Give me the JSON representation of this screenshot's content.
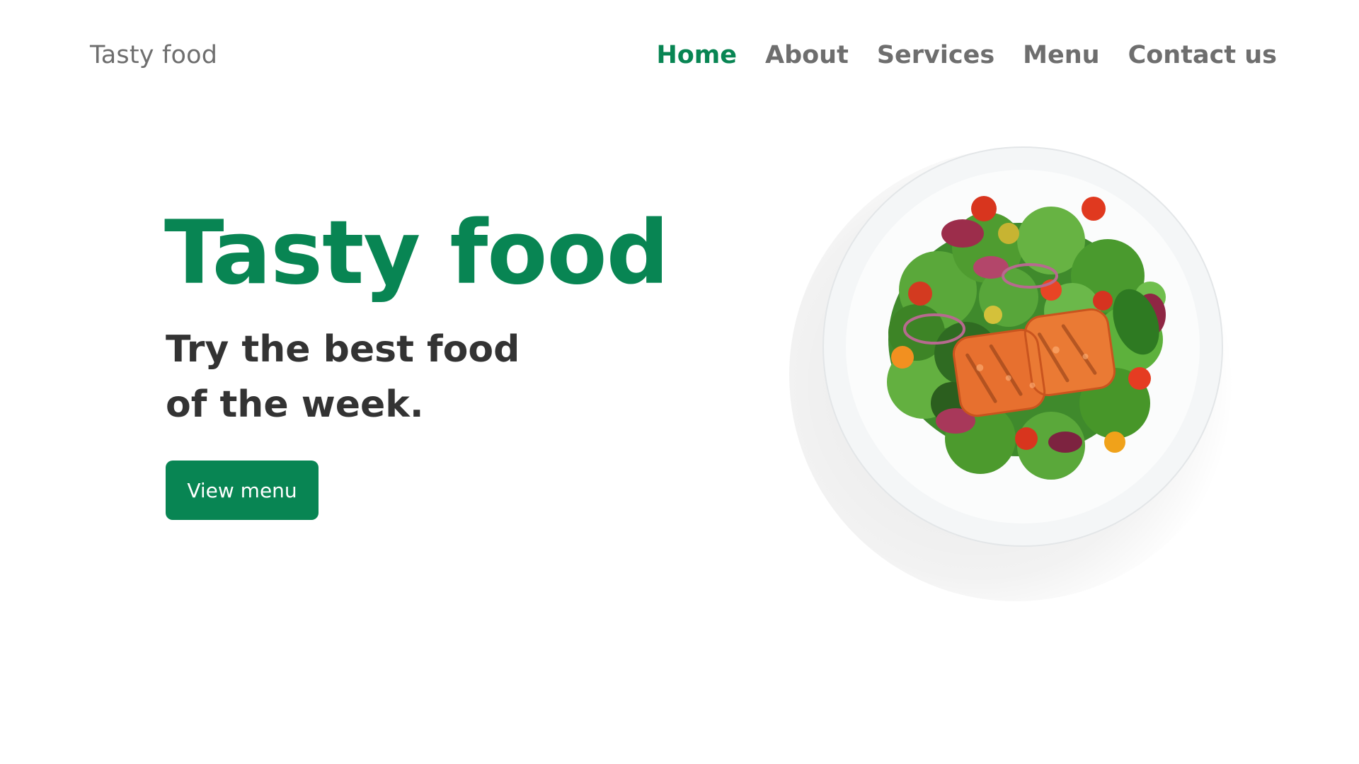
{
  "header": {
    "logo": "Tasty food",
    "nav": [
      {
        "label": "Home",
        "active": true
      },
      {
        "label": "About",
        "active": false
      },
      {
        "label": "Services",
        "active": false
      },
      {
        "label": "Menu",
        "active": false
      },
      {
        "label": "Contact us",
        "active": false
      }
    ]
  },
  "hero": {
    "title": "Tasty food",
    "subtitle": "Try the best food of the week.",
    "button_label": "View menu",
    "image_subject": "salmon-salad-plate"
  },
  "colors": {
    "brand_green": "#088553",
    "nav_text": "#6e6e6e",
    "body_text": "#333333",
    "background": "#ffffff"
  }
}
